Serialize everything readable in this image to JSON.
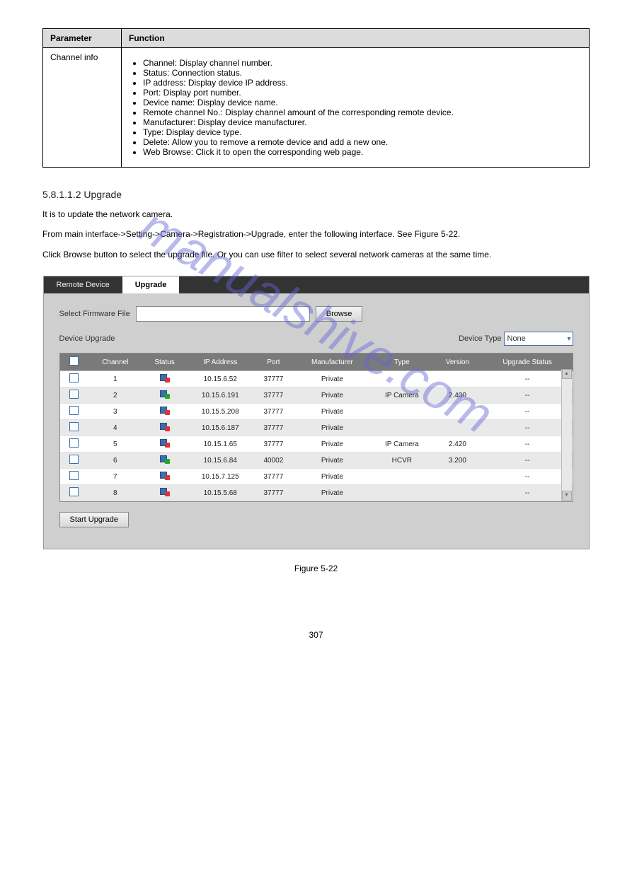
{
  "watermark": "manualshive.com",
  "paramTable": {
    "headerParam": "Parameter",
    "headerFunc": "Function",
    "row": {
      "param": "Channel info",
      "items": [
        "Channel: Display channel number.",
        "Status: Connection status.",
        "IP address: Display device IP address.",
        "Port: Display port number.",
        "Device name: Display device name.",
        "Remote channel No.: Display channel amount of the corresponding remote device.",
        "Manufacturer: Display device manufacturer.",
        "Type: Display device type.",
        "Delete: Allow you to remove a remote device and add a new one.",
        "Web Browse: Click it to open the corresponding web page."
      ]
    }
  },
  "section": {
    "heading": "5.8.1.1.2 Upgrade",
    "para1": "It is to update the network camera.",
    "para2": "From main interface->Setting->Camera->Registration->Upgrade, enter the following interface. See Figure 5-22.",
    "para3": "Click Browse button to select the upgrade file. Or you can use filter to select several network cameras at the same time."
  },
  "figure": {
    "tabs": {
      "remote": "Remote Device",
      "upgrade": "Upgrade"
    },
    "labels": {
      "selectFirmware": "Select Firmware File",
      "browse": "Browse",
      "deviceUpgrade": "Device Upgrade",
      "deviceType": "Device Type",
      "deviceTypeValue": "None",
      "startUpgrade": "Start Upgrade"
    },
    "columns": [
      "",
      "Channel",
      "Status",
      "IP Address",
      "Port",
      "Manufacturer",
      "Type",
      "Version",
      "Upgrade Status"
    ],
    "rows": [
      {
        "ch": "1",
        "status": "red",
        "ip": "10.15.6.52",
        "port": "37777",
        "mfr": "Private",
        "type": "",
        "ver": "",
        "us": "--"
      },
      {
        "ch": "2",
        "status": "green",
        "ip": "10.15.6.191",
        "port": "37777",
        "mfr": "Private",
        "type": "IP Camera",
        "ver": "2.400",
        "us": "--"
      },
      {
        "ch": "3",
        "status": "red",
        "ip": "10.15.5.208",
        "port": "37777",
        "mfr": "Private",
        "type": "",
        "ver": "",
        "us": "--"
      },
      {
        "ch": "4",
        "status": "red",
        "ip": "10.15.6.187",
        "port": "37777",
        "mfr": "Private",
        "type": "",
        "ver": "",
        "us": "--"
      },
      {
        "ch": "5",
        "status": "red",
        "ip": "10.15.1.65",
        "port": "37777",
        "mfr": "Private",
        "type": "IP Camera",
        "ver": "2.420",
        "us": "--"
      },
      {
        "ch": "6",
        "status": "green",
        "ip": "10.15.6.84",
        "port": "40002",
        "mfr": "Private",
        "type": "HCVR",
        "ver": "3.200",
        "us": "--"
      },
      {
        "ch": "7",
        "status": "red",
        "ip": "10.15.7.125",
        "port": "37777",
        "mfr": "Private",
        "type": "",
        "ver": "",
        "us": "--"
      },
      {
        "ch": "8",
        "status": "red",
        "ip": "10.15.5.68",
        "port": "37777",
        "mfr": "Private",
        "type": "",
        "ver": "",
        "us": "--"
      }
    ],
    "caption": "Figure 5-22"
  },
  "footer": "307"
}
